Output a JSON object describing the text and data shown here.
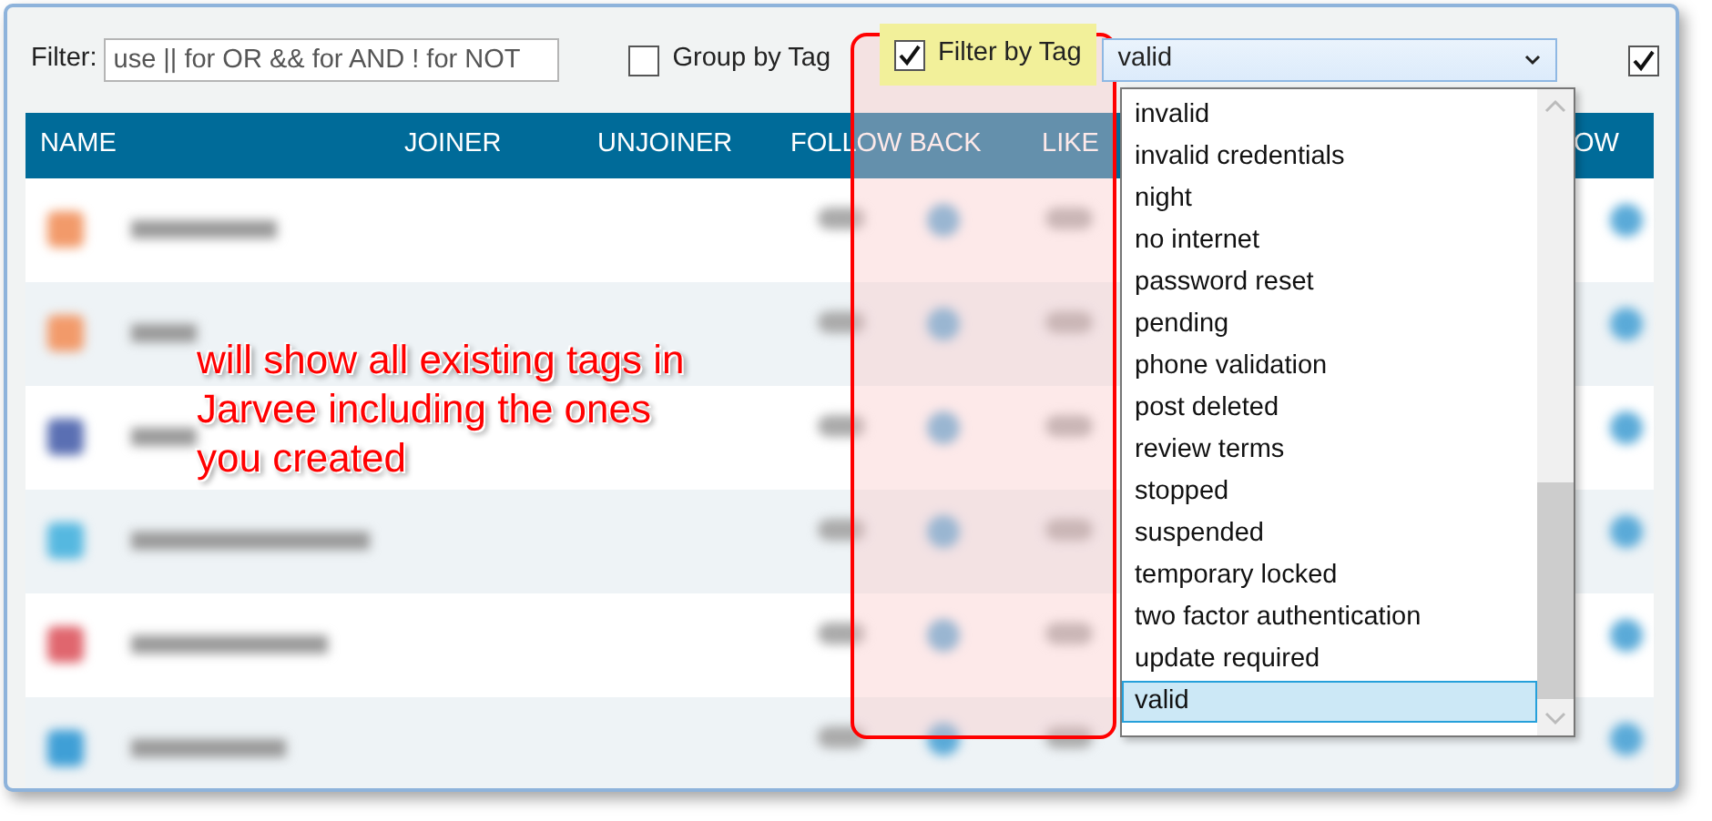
{
  "filter": {
    "label": "Filter:",
    "placeholder": "use || for OR && for AND ! for NOT"
  },
  "group_by_tag": {
    "label": "Group by Tag",
    "checked": false
  },
  "filter_by_tag": {
    "label": "Filter by Tag",
    "checked": true,
    "highlighted": true
  },
  "extra_checkbox": {
    "checked": true
  },
  "tag_select": {
    "value": "valid",
    "options": [
      {
        "label": "invalid",
        "selected": false
      },
      {
        "label": "invalid credentials",
        "selected": false
      },
      {
        "label": "night",
        "selected": false
      },
      {
        "label": "no internet",
        "selected": false
      },
      {
        "label": "password reset",
        "selected": false
      },
      {
        "label": "pending",
        "selected": false
      },
      {
        "label": "phone validation",
        "selected": false
      },
      {
        "label": "post deleted",
        "selected": false
      },
      {
        "label": "review terms",
        "selected": false
      },
      {
        "label": "stopped",
        "selected": false
      },
      {
        "label": "suspended",
        "selected": false
      },
      {
        "label": "temporary locked",
        "selected": false
      },
      {
        "label": "two factor authentication",
        "selected": false
      },
      {
        "label": "update required",
        "selected": false
      },
      {
        "label": "valid",
        "selected": true
      }
    ]
  },
  "table": {
    "columns": [
      "NAME",
      "JOINER",
      "UNJOINER",
      "FOLLOW BACK",
      "LIKE",
      "OW"
    ],
    "rows": [
      {
        "color": "#f29a6a"
      },
      {
        "color": "#f29a6a"
      },
      {
        "color": "#5a6fb3"
      },
      {
        "color": "#55b8e0"
      },
      {
        "color": "#e0666e"
      },
      {
        "color": "#3f9fd6"
      }
    ]
  },
  "annotation": {
    "lines": [
      "will show all existing tags in",
      "Jarvee including the ones",
      "you created"
    ]
  }
}
